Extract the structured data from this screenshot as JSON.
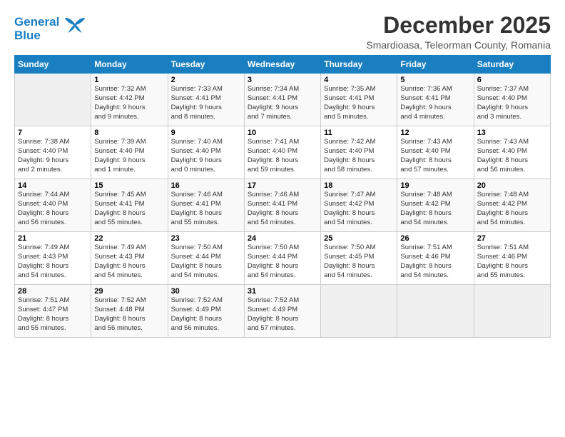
{
  "logo": {
    "line1": "General",
    "line2": "Blue"
  },
  "title": "December 2025",
  "subtitle": "Smardioasa, Teleorman County, Romania",
  "weekdays": [
    "Sunday",
    "Monday",
    "Tuesday",
    "Wednesday",
    "Thursday",
    "Friday",
    "Saturday"
  ],
  "weeks": [
    [
      {
        "day": "",
        "info": ""
      },
      {
        "day": "1",
        "info": "Sunrise: 7:32 AM\nSunset: 4:42 PM\nDaylight: 9 hours\nand 9 minutes."
      },
      {
        "day": "2",
        "info": "Sunrise: 7:33 AM\nSunset: 4:41 PM\nDaylight: 9 hours\nand 8 minutes."
      },
      {
        "day": "3",
        "info": "Sunrise: 7:34 AM\nSunset: 4:41 PM\nDaylight: 9 hours\nand 7 minutes."
      },
      {
        "day": "4",
        "info": "Sunrise: 7:35 AM\nSunset: 4:41 PM\nDaylight: 9 hours\nand 5 minutes."
      },
      {
        "day": "5",
        "info": "Sunrise: 7:36 AM\nSunset: 4:41 PM\nDaylight: 9 hours\nand 4 minutes."
      },
      {
        "day": "6",
        "info": "Sunrise: 7:37 AM\nSunset: 4:40 PM\nDaylight: 9 hours\nand 3 minutes."
      }
    ],
    [
      {
        "day": "7",
        "info": "Sunrise: 7:38 AM\nSunset: 4:40 PM\nDaylight: 9 hours\nand 2 minutes."
      },
      {
        "day": "8",
        "info": "Sunrise: 7:39 AM\nSunset: 4:40 PM\nDaylight: 9 hours\nand 1 minute."
      },
      {
        "day": "9",
        "info": "Sunrise: 7:40 AM\nSunset: 4:40 PM\nDaylight: 9 hours\nand 0 minutes."
      },
      {
        "day": "10",
        "info": "Sunrise: 7:41 AM\nSunset: 4:40 PM\nDaylight: 8 hours\nand 59 minutes."
      },
      {
        "day": "11",
        "info": "Sunrise: 7:42 AM\nSunset: 4:40 PM\nDaylight: 8 hours\nand 58 minutes."
      },
      {
        "day": "12",
        "info": "Sunrise: 7:43 AM\nSunset: 4:40 PM\nDaylight: 8 hours\nand 57 minutes."
      },
      {
        "day": "13",
        "info": "Sunrise: 7:43 AM\nSunset: 4:40 PM\nDaylight: 8 hours\nand 56 minutes."
      }
    ],
    [
      {
        "day": "14",
        "info": "Sunrise: 7:44 AM\nSunset: 4:40 PM\nDaylight: 8 hours\nand 56 minutes."
      },
      {
        "day": "15",
        "info": "Sunrise: 7:45 AM\nSunset: 4:41 PM\nDaylight: 8 hours\nand 55 minutes."
      },
      {
        "day": "16",
        "info": "Sunrise: 7:46 AM\nSunset: 4:41 PM\nDaylight: 8 hours\nand 55 minutes."
      },
      {
        "day": "17",
        "info": "Sunrise: 7:46 AM\nSunset: 4:41 PM\nDaylight: 8 hours\nand 54 minutes."
      },
      {
        "day": "18",
        "info": "Sunrise: 7:47 AM\nSunset: 4:42 PM\nDaylight: 8 hours\nand 54 minutes."
      },
      {
        "day": "19",
        "info": "Sunrise: 7:48 AM\nSunset: 4:42 PM\nDaylight: 8 hours\nand 54 minutes."
      },
      {
        "day": "20",
        "info": "Sunrise: 7:48 AM\nSunset: 4:42 PM\nDaylight: 8 hours\nand 54 minutes."
      }
    ],
    [
      {
        "day": "21",
        "info": "Sunrise: 7:49 AM\nSunset: 4:43 PM\nDaylight: 8 hours\nand 54 minutes."
      },
      {
        "day": "22",
        "info": "Sunrise: 7:49 AM\nSunset: 4:43 PM\nDaylight: 8 hours\nand 54 minutes."
      },
      {
        "day": "23",
        "info": "Sunrise: 7:50 AM\nSunset: 4:44 PM\nDaylight: 8 hours\nand 54 minutes."
      },
      {
        "day": "24",
        "info": "Sunrise: 7:50 AM\nSunset: 4:44 PM\nDaylight: 8 hours\nand 54 minutes."
      },
      {
        "day": "25",
        "info": "Sunrise: 7:50 AM\nSunset: 4:45 PM\nDaylight: 8 hours\nand 54 minutes."
      },
      {
        "day": "26",
        "info": "Sunrise: 7:51 AM\nSunset: 4:46 PM\nDaylight: 8 hours\nand 54 minutes."
      },
      {
        "day": "27",
        "info": "Sunrise: 7:51 AM\nSunset: 4:46 PM\nDaylight: 8 hours\nand 55 minutes."
      }
    ],
    [
      {
        "day": "28",
        "info": "Sunrise: 7:51 AM\nSunset: 4:47 PM\nDaylight: 8 hours\nand 55 minutes."
      },
      {
        "day": "29",
        "info": "Sunrise: 7:52 AM\nSunset: 4:48 PM\nDaylight: 8 hours\nand 56 minutes."
      },
      {
        "day": "30",
        "info": "Sunrise: 7:52 AM\nSunset: 4:49 PM\nDaylight: 8 hours\nand 56 minutes."
      },
      {
        "day": "31",
        "info": "Sunrise: 7:52 AM\nSunset: 4:49 PM\nDaylight: 8 hours\nand 57 minutes."
      },
      {
        "day": "",
        "info": ""
      },
      {
        "day": "",
        "info": ""
      },
      {
        "day": "",
        "info": ""
      }
    ]
  ]
}
